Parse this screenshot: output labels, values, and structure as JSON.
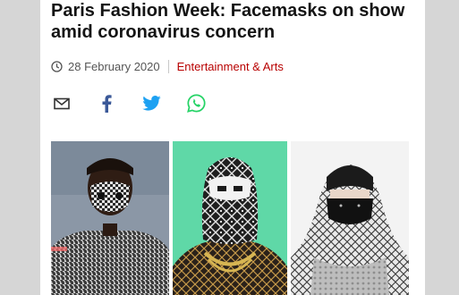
{
  "article": {
    "headline": "Paris Fashion Week: Facemasks on show amid coronavirus concern",
    "date": "28 February 2020",
    "category": "Entertainment & Arts"
  },
  "share": [
    {
      "name": "email",
      "icon": "email-icon"
    },
    {
      "name": "facebook",
      "icon": "facebook-icon"
    },
    {
      "name": "twitter",
      "icon": "twitter-icon"
    },
    {
      "name": "whatsapp",
      "icon": "whatsapp-icon"
    }
  ],
  "colors": {
    "category": "#b80000",
    "facebook": "#3b5998",
    "twitter": "#1da1f2",
    "whatsapp": "#25d366"
  },
  "photos": [
    {
      "name": "model-in-houndstooth-mask"
    },
    {
      "name": "model-in-patterned-balaclava"
    },
    {
      "name": "model-in-black-mask-and-scarf"
    }
  ]
}
